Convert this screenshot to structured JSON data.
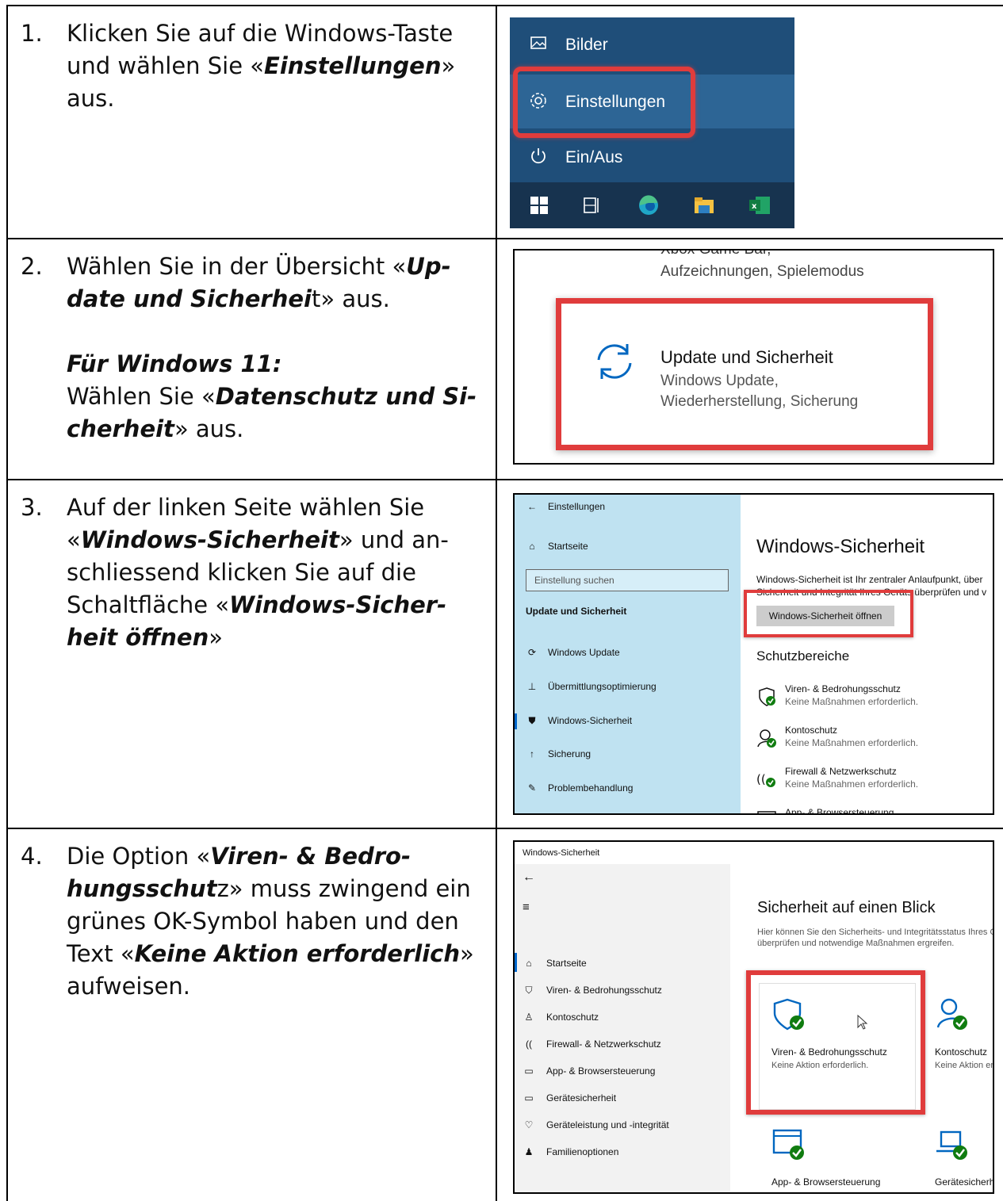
{
  "rows": [
    {
      "num": "1.",
      "lines": [
        [
          "Klicken Sie auf die Windows-Taste"
        ],
        [
          "und wählen Sie «",
          {
            "b": "Einstellungen"
          },
          "»"
        ],
        [
          "aus."
        ]
      ]
    },
    {
      "num": "2.",
      "lines": [
        [
          "Wählen Sie in der Übersicht «",
          {
            "b": "Up-"
          }
        ],
        [
          {
            "b": "date und Sicherhei"
          },
          "t» aus."
        ],
        [
          "__gap__"
        ],
        [
          {
            "b": "Für Windows 11:"
          }
        ],
        [
          "Wählen Sie «",
          {
            "b": "Datenschutz und Si-"
          }
        ],
        [
          {
            "b": "cherheit"
          },
          "» aus."
        ]
      ]
    },
    {
      "num": "3.",
      "lines": [
        [
          "Auf der linken Seite wählen Sie"
        ],
        [
          "«",
          {
            "b": "Windows-Sicherheit"
          },
          "» und an-"
        ],
        [
          "schliessend klicken Sie auf die"
        ],
        [
          "Schaltfläche «",
          {
            "b": "Windows-Sicher-"
          }
        ],
        [
          {
            "b": "heit öffnen"
          },
          "»"
        ]
      ]
    },
    {
      "num": "4.",
      "lines": [
        [
          "Die Option «",
          {
            "b": "Viren- & Bedro-"
          }
        ],
        [
          {
            "b": "hungsschut"
          },
          "z» muss zwingend ein"
        ],
        [
          "grünes OK-Symbol haben und den"
        ],
        [
          "Text «",
          {
            "b": "Keine Aktion erforderlich"
          },
          "»"
        ],
        [
          "aufweisen."
        ]
      ]
    }
  ],
  "shot1": {
    "items": [
      {
        "icon": "image-icon",
        "label": "Bilder"
      },
      {
        "icon": "gear-icon",
        "label": "Einstellungen"
      },
      {
        "icon": "power-icon",
        "label": "Ein/Aus"
      }
    ],
    "taskbar": [
      "windows-start-icon",
      "task-view-icon",
      "edge-icon",
      "file-explorer-icon",
      "excel-icon"
    ],
    "colors": {
      "bg": "#1f4e79",
      "highlight": "#2d6595",
      "taskbar": "#17334f",
      "red": "#e03c3c"
    }
  },
  "shot2": {
    "top_line": "Xbox Game Bar,",
    "top_line2": "Aufzeichnungen, Spielemodus",
    "icon": "sync-icon",
    "title": "Update und Sicherheit",
    "sub1": "Windows Update,",
    "sub2": "Wiederherstellung, Sicherung"
  },
  "shot3": {
    "back": "Einstellungen",
    "home": "Startseite",
    "search_placeholder": "Einstellung suchen",
    "section": "Update und Sicherheit",
    "nav": [
      "Windows Update",
      "Übermittlungsoptimierung",
      "Windows-Sicherheit",
      "Sicherung",
      "Problembehandlung"
    ],
    "title": "Windows-Sicherheit",
    "desc1": "Windows-Sicherheit ist Ihr zentraler Anlaufpunkt, über",
    "desc2": "Sicherheit und Integrität Ihres Geräts überprüfen und v",
    "button": "Windows-Sicherheit öffnen",
    "areas_title": "Schutzbereiche",
    "areas": [
      {
        "title": "Viren- & Bedrohungsschutz",
        "status": "Keine Maßnahmen erforderlich."
      },
      {
        "title": "Kontoschutz",
        "status": "Keine Maßnahmen erforderlich."
      },
      {
        "title": "Firewall & Netzwerkschutz",
        "status": "Keine Maßnahmen erforderlich."
      },
      {
        "title": "App- & Browsersteuerung",
        "status": ""
      }
    ]
  },
  "shot4": {
    "header": "Windows-Sicherheit",
    "nav": [
      "Startseite",
      "Viren- & Bedrohungsschutz",
      "Kontoschutz",
      "Firewall- & Netzwerkschutz",
      "App- & Browsersteuerung",
      "Gerätesicherheit",
      "Geräteleistung und -integrität",
      "Familienoptionen"
    ],
    "title": "Sicherheit auf einen Blick",
    "desc1": "Hier können Sie den Sicherheits- und Integritätsstatus Ihres G",
    "desc2": "überprüfen und notwendige Maßnahmen ergreifen.",
    "cards": [
      {
        "title": "Viren- & Bedrohungsschutz",
        "status": "Keine Aktion erforderlich."
      },
      {
        "title": "Kontoschutz",
        "status": "Keine Aktion er"
      },
      {
        "title": "App- & Browsersteuerung",
        "status": ""
      },
      {
        "title": "Gerätesicherh",
        "status": ""
      }
    ]
  }
}
